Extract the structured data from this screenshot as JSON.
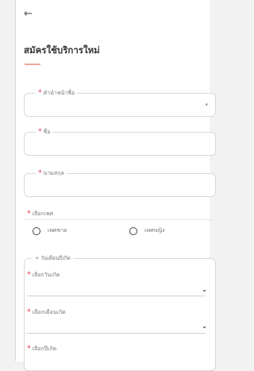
{
  "header": {
    "back_icon": "arrow-left-icon",
    "title": "สมัครใช้บริการใหม่"
  },
  "form": {
    "prefix_label": "คำนำหน้าชื่อ",
    "first_name_label": "ชื่อ",
    "last_name_label": "นามสกุล",
    "gender_label": "เลือกเพศ",
    "gender_options": [
      "เพศชาย",
      "เพศหญิง"
    ],
    "birth_legend": "+ วันเดือนปีเกิด",
    "birth_day_label": "เลือกวันเกิด",
    "birth_month_label": "เลือกเดือนเกิด",
    "birth_year_label": "เลือกปีเกิด",
    "required_mark": "*"
  },
  "colors": {
    "required": "#e0303a",
    "underline": "#f0a79a",
    "border": "#d9d9d9"
  }
}
